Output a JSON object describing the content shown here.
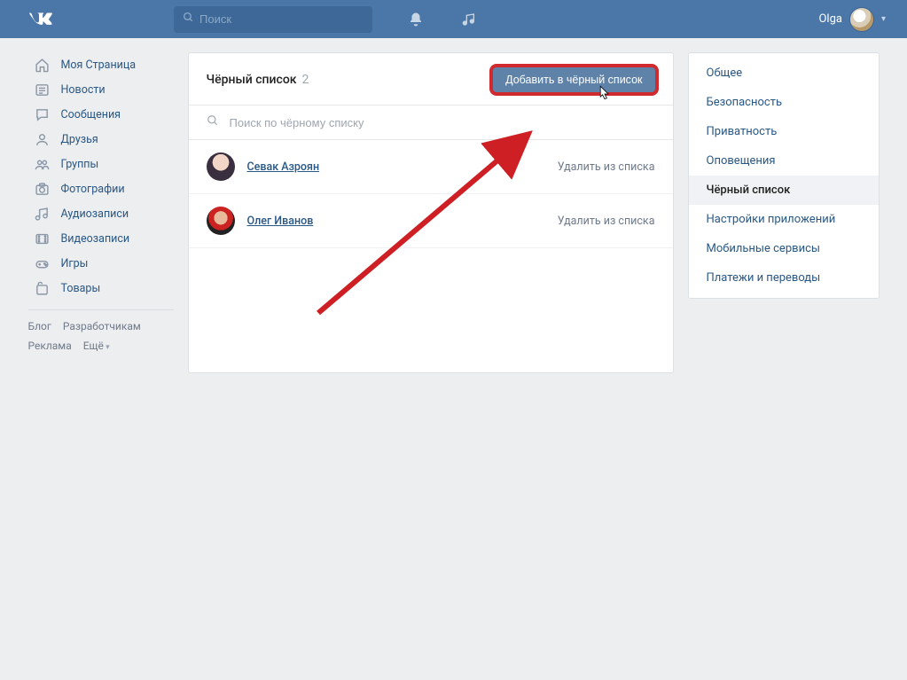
{
  "header": {
    "search_placeholder": "Поиск",
    "user_name": "Olga"
  },
  "left_nav": {
    "items": [
      {
        "icon": "home",
        "label": "Моя Страница"
      },
      {
        "icon": "news",
        "label": "Новости"
      },
      {
        "icon": "msg",
        "label": "Сообщения"
      },
      {
        "icon": "friends",
        "label": "Друзья"
      },
      {
        "icon": "groups",
        "label": "Группы"
      },
      {
        "icon": "photo",
        "label": "Фотографии"
      },
      {
        "icon": "audio",
        "label": "Аудиозаписи"
      },
      {
        "icon": "video",
        "label": "Видеозаписи"
      },
      {
        "icon": "game",
        "label": "Игры"
      },
      {
        "icon": "market",
        "label": "Товары"
      }
    ],
    "meta": {
      "blog": "Блог",
      "devs": "Разработчикам",
      "ads": "Реклама",
      "more": "Ещё"
    }
  },
  "blacklist": {
    "title": "Чёрный список",
    "count": "2",
    "add_button": "Добавить в чёрный список",
    "search_placeholder": "Поиск по чёрному списку",
    "remove_label": "Удалить из списка",
    "people": [
      {
        "name": "Севак Азроян"
      },
      {
        "name": "Олег Иванов"
      }
    ]
  },
  "settings_nav": {
    "items": [
      "Общее",
      "Безопасность",
      "Приватность",
      "Оповещения",
      "Чёрный список",
      "Настройки приложений",
      "Мобильные сервисы",
      "Платежи и переводы"
    ],
    "active_index": 4
  }
}
